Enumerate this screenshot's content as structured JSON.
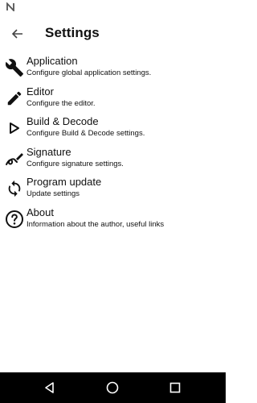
{
  "app_bar": {
    "title": "Settings",
    "back_icon": "arrow-left-icon"
  },
  "status_bar": {
    "notification_icon": "n-notification-icon"
  },
  "settings": [
    {
      "icon": "wrench-icon",
      "label": "Application",
      "subtitle": "Configure global application settings."
    },
    {
      "icon": "pencil-icon",
      "label": "Editor",
      "subtitle": "Configure the editor."
    },
    {
      "icon": "play-icon",
      "label": "Build & Decode",
      "subtitle": "Configure Build & Decode settings."
    },
    {
      "icon": "signature-icon",
      "label": "Signature",
      "subtitle": "Configure signature settings."
    },
    {
      "icon": "sync-icon",
      "label": "Program update",
      "subtitle": "Update settings"
    },
    {
      "icon": "help-circle-icon",
      "label": "About",
      "subtitle": "Information about the author, useful links"
    }
  ],
  "nav_bar": {
    "back_icon": "nav-back-triangle-icon",
    "home_icon": "nav-home-circle-icon",
    "recents_icon": "nav-recents-square-icon",
    "background_color": "#000000"
  }
}
